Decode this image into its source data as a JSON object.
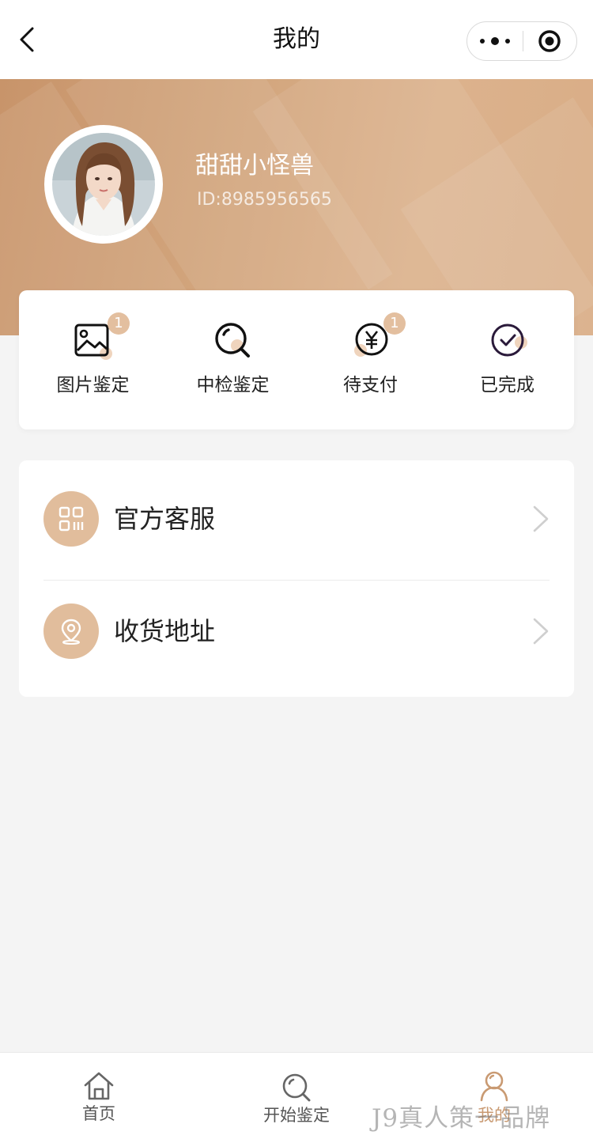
{
  "nav": {
    "title": "我的",
    "back_icon": "chevron-left-icon",
    "capsule_more_icon": "more-dots-icon",
    "capsule_close_icon": "record-target-icon"
  },
  "profile": {
    "name": "甜甜小怪兽",
    "id_text": "ID:8985956565"
  },
  "orders": {
    "items": [
      {
        "label": "图片鉴定",
        "icon": "image-icon",
        "badge": "1"
      },
      {
        "label": "中检鉴定",
        "icon": "magnifier-icon",
        "badge": ""
      },
      {
        "label": "待支付",
        "icon": "yen-icon",
        "badge": "1"
      },
      {
        "label": "已完成",
        "icon": "check-circle-icon",
        "badge": ""
      }
    ]
  },
  "menu": {
    "items": [
      {
        "label": "官方客服",
        "icon": "qr-code-icon"
      },
      {
        "label": "收货地址",
        "icon": "location-pin-icon"
      }
    ]
  },
  "tabbar": {
    "items": [
      {
        "label": "首页",
        "icon": "home-icon",
        "active": false
      },
      {
        "label": "开始鉴定",
        "icon": "magnifier-icon",
        "active": false
      },
      {
        "label": "我的",
        "icon": "user-icon",
        "active": true
      }
    ]
  },
  "watermark": "J9真人策一品牌",
  "colors": {
    "accent": "#e1bd9c",
    "accent_dark": "#c99a72",
    "banner": "#d4a880",
    "background": "#f4f4f4"
  }
}
